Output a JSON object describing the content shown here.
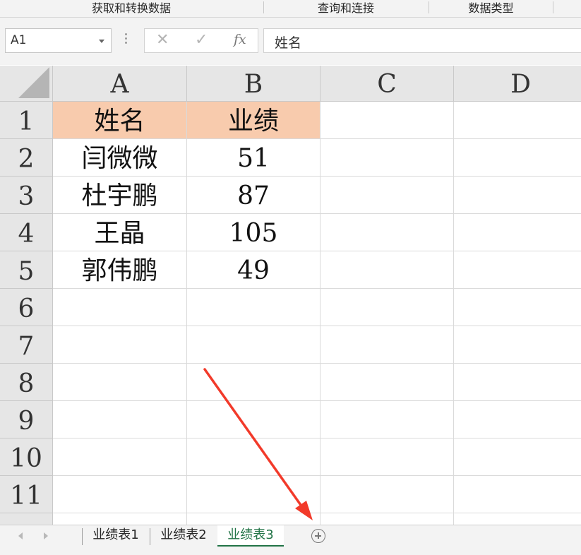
{
  "ribbon": {
    "groups": [
      "获取和转换数据",
      "查询和连接",
      "数据类型"
    ]
  },
  "formula_bar": {
    "name_box": "A1",
    "cancel_glyph": "✕",
    "enter_glyph": "✓",
    "fx_label": "fx",
    "content": "姓名"
  },
  "grid": {
    "columns": [
      "A",
      "B",
      "C",
      "D"
    ],
    "rows": [
      "1",
      "2",
      "3",
      "4",
      "5",
      "6",
      "7",
      "8",
      "9",
      "10",
      "11"
    ],
    "cells": [
      [
        "姓名",
        "业绩"
      ],
      [
        "闫微微",
        "51"
      ],
      [
        "杜宇鹏",
        "87"
      ],
      [
        "王晶",
        "105"
      ],
      [
        "郭伟鹏",
        "49"
      ]
    ]
  },
  "header_fill_color": "#f8cbad",
  "annotation_color": "#f23a2a",
  "sheet_tabs": {
    "tabs": [
      "业绩表1",
      "业绩表2",
      "业绩表3"
    ],
    "active": "业绩表3",
    "add_icon": "plus-circle-icon"
  }
}
